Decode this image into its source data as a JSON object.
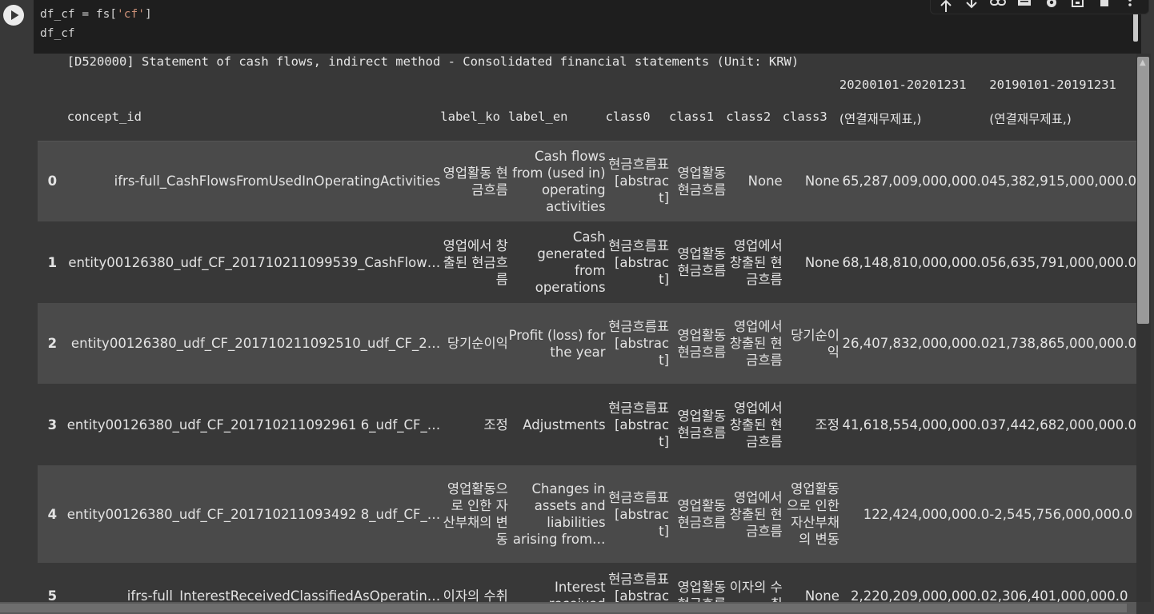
{
  "code_cell": {
    "line1_prefix": "df_cf = fs[",
    "line1_string": "'cf'",
    "line1_suffix": "]",
    "line2": "df_cf"
  },
  "toolbar": {
    "icons": [
      "arrow-up-icon",
      "arrow-down-icon",
      "link-icon",
      "comment-icon",
      "gear-icon",
      "mirror-cell-icon",
      "delete-icon",
      "more-icon"
    ]
  },
  "table": {
    "title": "[D520000] Statement of cash flows, indirect method - Consolidated financial statements (Unit: KRW)",
    "period_headers": [
      "20200101-20201231",
      "20190101-20191231"
    ],
    "column_names": [
      "concept_id",
      "label_ko",
      "label_en",
      "class0",
      "class1",
      "class2",
      "class3",
      "(연결재무제표,)",
      "(연결재무제표,)"
    ],
    "rows": [
      {
        "index": "0",
        "concept_id": "ifrs-full_CashFlowsFromUsedInOperatingActivities",
        "label_ko": "영업활동 현금흐름",
        "label_en": "Cash flows from (used in) operating activities",
        "class0": "현금흐름표 [abstract]",
        "class1": "영업활동 현금흐름",
        "class2": "None",
        "class3": "None",
        "v2020": "65,287,009,000,000.0",
        "v2019": "45,382,915,000,000.0"
      },
      {
        "index": "1",
        "concept_id": "entity00126380_udf_CF_201710211099539_CashFlow…",
        "label_ko": "영업에서 창출된 현금흐름",
        "label_en": "Cash generated from operations",
        "class0": "현금흐름표 [abstract]",
        "class1": "영업활동 현금흐름",
        "class2": "영업에서 창출된 현금흐름",
        "class3": "None",
        "v2020": "68,148,810,000,000.0",
        "v2019": "56,635,791,000,000.0"
      },
      {
        "index": "2",
        "concept_id": "entity00126380_udf_CF_201710211092510_udf_CF_2…",
        "label_ko": "당기순이익",
        "label_en": "Profit (loss) for the year",
        "class0": "현금흐름표 [abstract]",
        "class1": "영업활동 현금흐름",
        "class2": "영업에서 창출된 현금흐름",
        "class3": "당기순이익",
        "v2020": "26,407,832,000,000.0",
        "v2019": "21,738,865,000,000.0"
      },
      {
        "index": "3",
        "concept_id": "entity00126380_udf_CF_201710211092961 6_udf_CF_…",
        "label_ko": "조정",
        "label_en": "Adjustments",
        "class0": "현금흐름표 [abstract]",
        "class1": "영업활동 현금흐름",
        "class2": "영업에서 창출된 현금흐름",
        "class3": "조정",
        "v2020": "41,618,554,000,000.0",
        "v2019": "37,442,682,000,000.0"
      },
      {
        "index": "4",
        "concept_id": "entity00126380_udf_CF_201710211093492 8_udf_CF_…",
        "label_ko": "영업활동으로 인한 자산부채의 변동",
        "label_en": "Changes in assets and liabilities arising from…",
        "class0": "현금흐름표 [abstract]",
        "class1": "영업활동 현금흐름",
        "class2": "영업에서 창출된 현금흐름",
        "class3": "영업활동으로 인한 자산부채의 변동",
        "v2020": "122,424,000,000.0",
        "v2019": "-2,545,756,000,000.0"
      },
      {
        "index": "5",
        "concept_id": "ifrs-full_InterestReceivedClassifiedAsOperatin…",
        "label_ko": "이자의 수취",
        "label_en": "Interest received",
        "class0": "현금흐름표 [abstract]",
        "class1": "영업활동 현금흐름",
        "class2": "이자의 수취",
        "class3": "None",
        "v2020": "2,220,209,000,000.0",
        "v2019": "2,306,401,000,000.0"
      }
    ]
  }
}
